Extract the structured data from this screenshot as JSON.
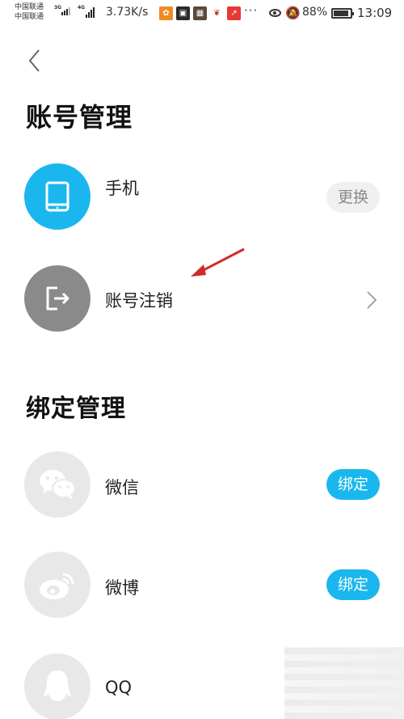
{
  "status_bar": {
    "carrier1": "中国联通",
    "carrier2": "中国联通",
    "net1": "3G",
    "net2": "4G",
    "speed": "3.73K/s",
    "overflow": "···",
    "battery": "88%",
    "battery_level": 0.88,
    "time": "13:09"
  },
  "header": {
    "title": "账号管理"
  },
  "account_items": [
    {
      "label": "手机",
      "action": "更换",
      "icon": "tablet-icon",
      "color": "#1ab7ee"
    },
    {
      "label": "账号注销",
      "icon": "logout-icon",
      "color": "#8a8a8a"
    }
  ],
  "binding": {
    "title": "绑定管理",
    "items": [
      {
        "label": "微信",
        "action": "绑定",
        "icon": "wechat-icon"
      },
      {
        "label": "微博",
        "action": "绑定",
        "icon": "weibo-icon"
      },
      {
        "label": "QQ",
        "icon": "qq-icon"
      }
    ]
  },
  "colors": {
    "accent": "#1ab7ee",
    "annotation": "#d42a2a"
  }
}
